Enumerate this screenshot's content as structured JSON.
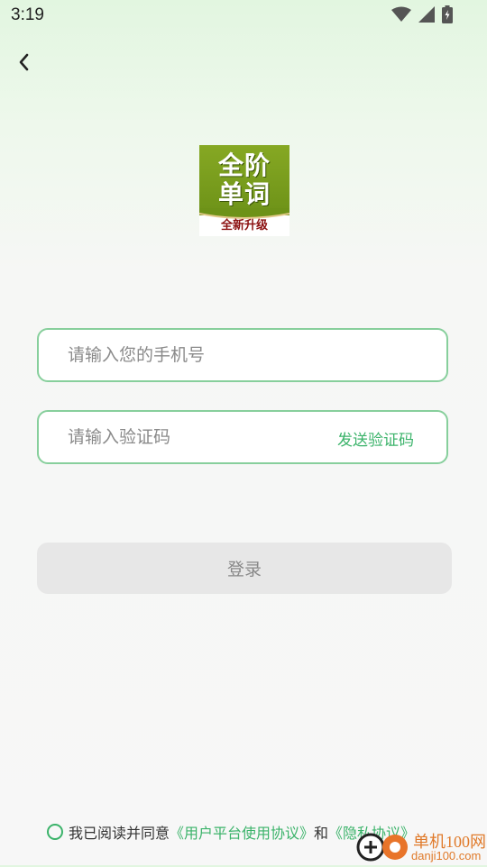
{
  "status_bar": {
    "time": "3:19",
    "icons": [
      "wifi-icon",
      "signal-icon",
      "battery-icon"
    ]
  },
  "nav": {
    "back_icon": "chevron-left-icon"
  },
  "logo": {
    "line1": "全阶",
    "line2": "单词",
    "subtitle": "全新升级",
    "colors": {
      "green": "#7a9e1f",
      "red": "#8b1010"
    }
  },
  "form": {
    "phone": {
      "placeholder": "请输入您的手机号",
      "value": ""
    },
    "code": {
      "placeholder": "请输入验证码",
      "value": "",
      "send_label": "发送验证码"
    },
    "login_label": "登录"
  },
  "agreement": {
    "prefix": "我已阅读并同意",
    "user_agreement": "《用户平台使用协议》",
    "conjunction": "和",
    "privacy_policy": "《隐私协议》",
    "checked": false
  },
  "watermark": {
    "name": "单机100网",
    "url": "danji100.com"
  },
  "colors": {
    "accent": "#3bb36a",
    "field_border": "#87cf9c",
    "button_bg": "#e7e7e7",
    "button_text": "#888888"
  }
}
